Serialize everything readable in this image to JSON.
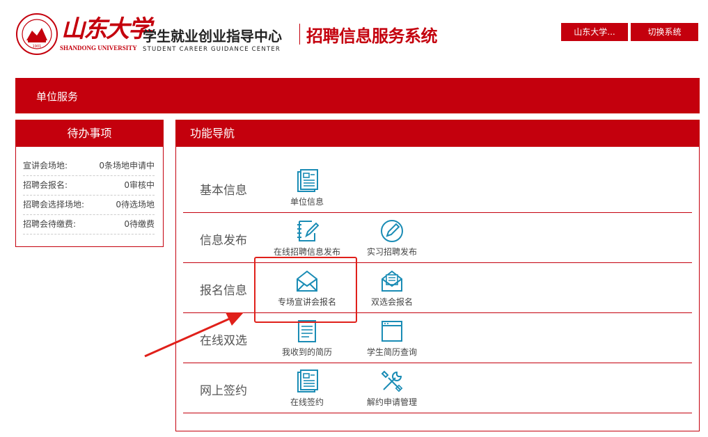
{
  "header": {
    "university_cn": "山东大学",
    "university_en": "SHANDONG UNIVERSITY",
    "center_cn": "学生就业创业指导中心",
    "center_en": "STUDENT  CAREER  GUIDANCE  CENTER",
    "system_title": "招聘信息服务系统",
    "user_button": "山东大学...",
    "switch_button": "切换系统"
  },
  "topbar": {
    "title": "单位服务"
  },
  "todo": {
    "title": "待办事项",
    "items": [
      {
        "label": "宣讲会场地:",
        "value": "0条场地申请中"
      },
      {
        "label": "招聘会报名:",
        "value": "0审核中"
      },
      {
        "label": "招聘会选择场地:",
        "value": "0待选场地"
      },
      {
        "label": "招聘会待缴费:",
        "value": "0待缴费"
      }
    ]
  },
  "nav": {
    "title": "功能导航",
    "rows": [
      {
        "label": "基本信息",
        "tiles": [
          {
            "label": "单位信息",
            "icon": "document-list-icon"
          }
        ]
      },
      {
        "label": "信息发布",
        "tiles": [
          {
            "label": "在线招聘信息发布",
            "icon": "edit-document-icon"
          },
          {
            "label": "实习招聘发布",
            "icon": "pen-circle-icon"
          }
        ]
      },
      {
        "label": "报名信息",
        "tiles": [
          {
            "label": "专场宣讲会报名",
            "icon": "envelope-open-icon"
          },
          {
            "label": "双选会报名",
            "icon": "envelope-letter-icon"
          }
        ]
      },
      {
        "label": "在线双选",
        "tiles": [
          {
            "label": "我收到的简历",
            "icon": "resume-icon"
          },
          {
            "label": "学生简历查询",
            "icon": "browser-window-icon"
          }
        ]
      },
      {
        "label": "网上签约",
        "tiles": [
          {
            "label": "在线签约",
            "icon": "document-list-icon"
          },
          {
            "label": "解约申请管理",
            "icon": "tools-icon"
          }
        ]
      }
    ]
  },
  "colors": {
    "brand": "#c4000d",
    "icon": "#1a8cb5",
    "annotation": "#e0201a"
  }
}
